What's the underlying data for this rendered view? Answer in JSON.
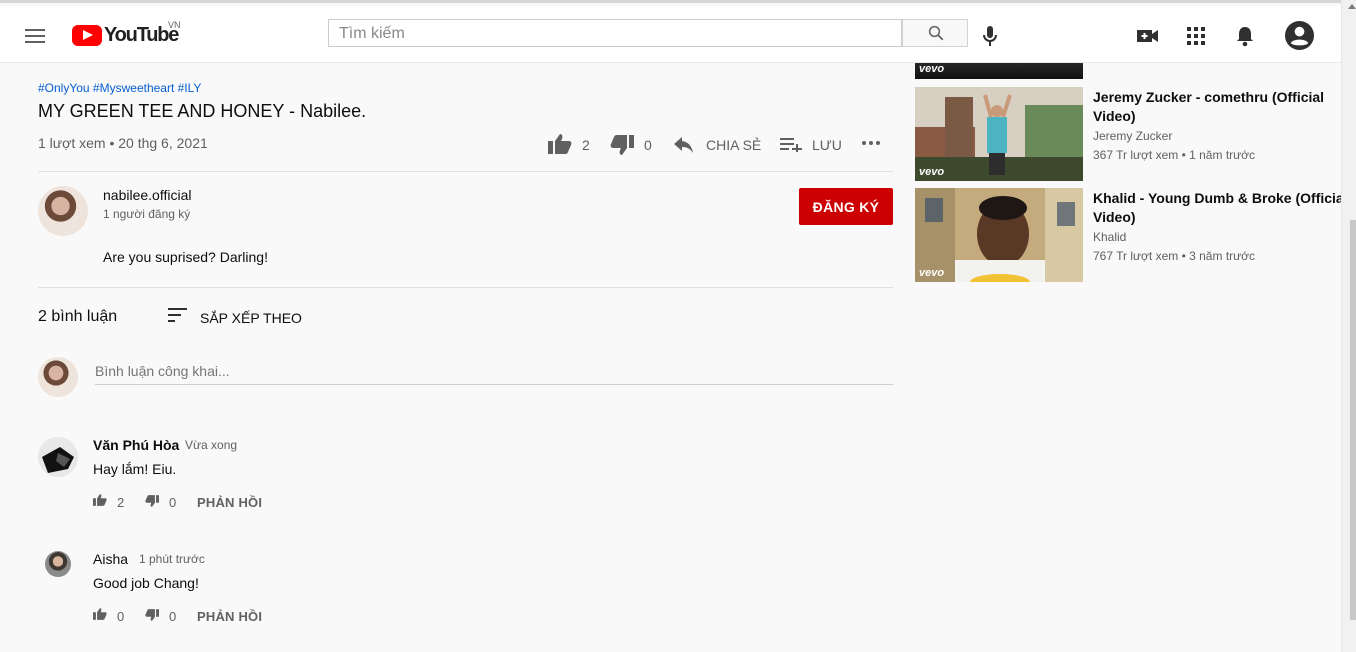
{
  "header": {
    "logo_text": "YouTube",
    "country_code": "VN",
    "search_placeholder": "Tìm kiếm"
  },
  "video": {
    "hashtags": "#OnlyYou #Mysweetheart #ILY",
    "title": "MY GREEN TEE AND HONEY - Nabilee.",
    "meta": "1 lượt xem • 20 thg 6, 2021",
    "likes": "2",
    "dislikes": "0",
    "share_label": "CHIA SẺ",
    "save_label": "LƯU"
  },
  "channel": {
    "name": "nabilee.official",
    "subscribers": "1 người đăng ký",
    "subscribe_label": "ĐĂNG KÝ",
    "description": "Are you suprised? Darling!"
  },
  "comments": {
    "count_label": "2 bình luận",
    "sort_label": "SẮP XẾP THEO",
    "input_placeholder": "Bình luận công khai...",
    "items": [
      {
        "author": "Văn Phú Hòa",
        "time": "Vừa xong",
        "text": "Hay lắm! Eiu.",
        "likes": "2",
        "dislikes": "0",
        "reply_label": "PHẢN HỒI"
      },
      {
        "author": "Aisha",
        "time": "1 phút trước",
        "text": "Good job Chang!",
        "likes": "0",
        "dislikes": "0",
        "reply_label": "PHẢN HỒI"
      }
    ]
  },
  "sidebar": {
    "items": [
      {
        "title_line1": "Jeremy Zucker - comethru (Official",
        "title_line2": "Video)",
        "channel": "Jeremy Zucker",
        "meta": "367 Tr lượt xem • 1 năm trước",
        "badge": "vevo"
      },
      {
        "title_line1": "Khalid - Young Dumb & Broke (Official",
        "title_line2": "Video)",
        "channel": "Khalid",
        "meta": "767 Tr lượt xem • 3 năm trước",
        "badge": "vevo"
      }
    ],
    "top_badge": "vevo"
  },
  "colors": {
    "accent_red": "#cc0000",
    "link_blue": "#065fd4",
    "muted_text": "#606060"
  }
}
